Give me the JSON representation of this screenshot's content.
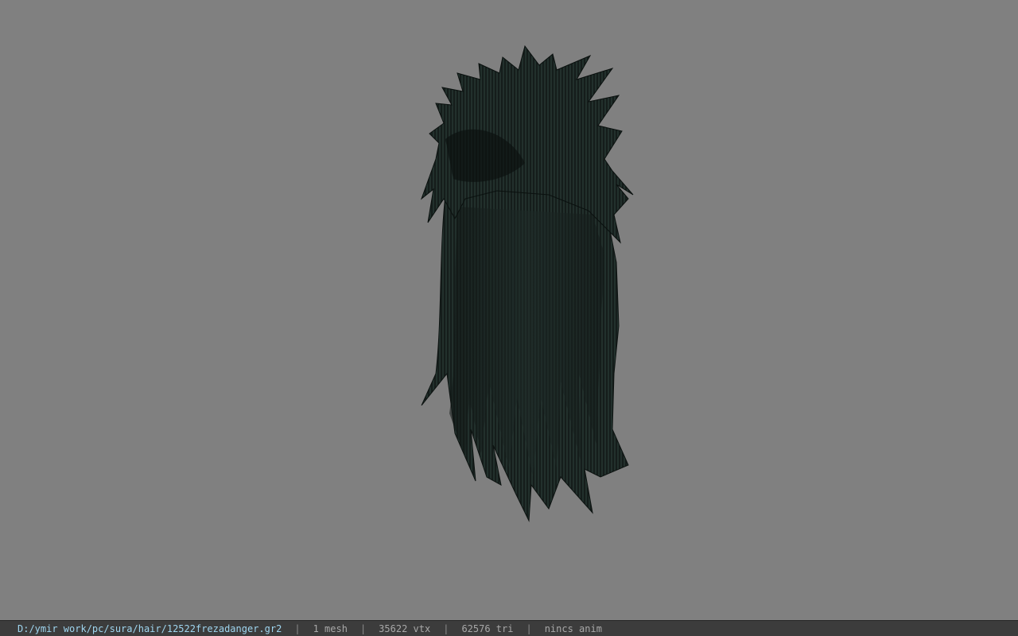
{
  "viewer": {
    "background_color": "#808080",
    "model": {
      "icon": "hair-mesh-icon",
      "base_color": "#1a2220",
      "highlight_color": "#3d5a52"
    }
  },
  "statusbar": {
    "path": "D:/ymir work/pc/sura/hair/12522frezadanger.gr2",
    "separator": "|",
    "mesh_count": "1 mesh",
    "vertex_count": "35622 vtx",
    "triangle_count": "62576 tri",
    "anim_status": "nincs anim"
  }
}
